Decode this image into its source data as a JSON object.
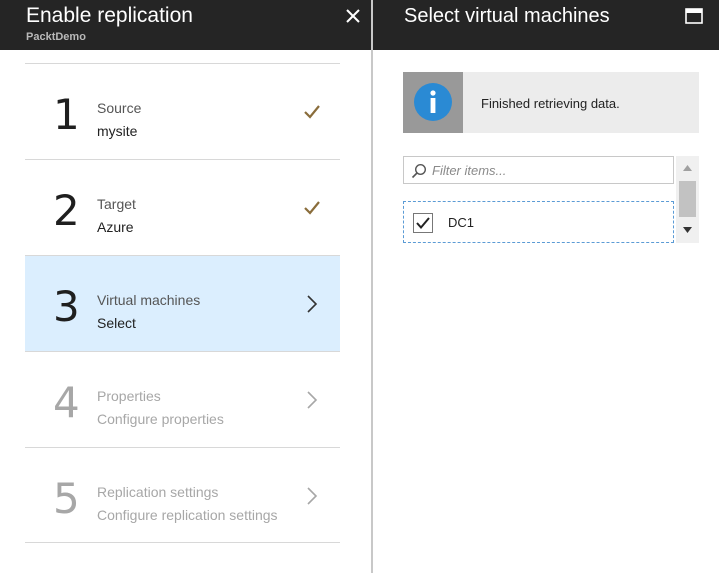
{
  "left_blade": {
    "title": "Enable replication",
    "subtitle": "PacktDemo",
    "close_icon": "close-icon",
    "steps": [
      {
        "number": "1",
        "title": "Source",
        "subtitle": "mysite",
        "state": "completed",
        "icon": "checkmark-icon"
      },
      {
        "number": "2",
        "title": "Target",
        "subtitle": "Azure",
        "state": "completed",
        "icon": "checkmark-icon"
      },
      {
        "number": "3",
        "title": "Virtual machines",
        "subtitle": "Select",
        "state": "active",
        "icon": "chevron-right-icon"
      },
      {
        "number": "4",
        "title": "Properties",
        "subtitle": "Configure properties",
        "state": "disabled",
        "icon": "chevron-right-icon"
      },
      {
        "number": "5",
        "title": "Replication settings",
        "subtitle": "Configure replication settings",
        "state": "disabled",
        "icon": "chevron-right-icon"
      }
    ]
  },
  "right_blade": {
    "title": "Select virtual machines",
    "maximize_icon": "maximize-icon",
    "info": {
      "icon": "info-icon",
      "message": "Finished retrieving data."
    },
    "filter": {
      "placeholder": "Filter items...",
      "value": ""
    },
    "vm_list": [
      {
        "name": "DC1",
        "checked": true
      }
    ]
  },
  "colors": {
    "header_bg": "#252525",
    "active_step_bg": "#dbeefe",
    "checkmark": "#8a6d3b",
    "info_icon": "#2a8ad4"
  }
}
